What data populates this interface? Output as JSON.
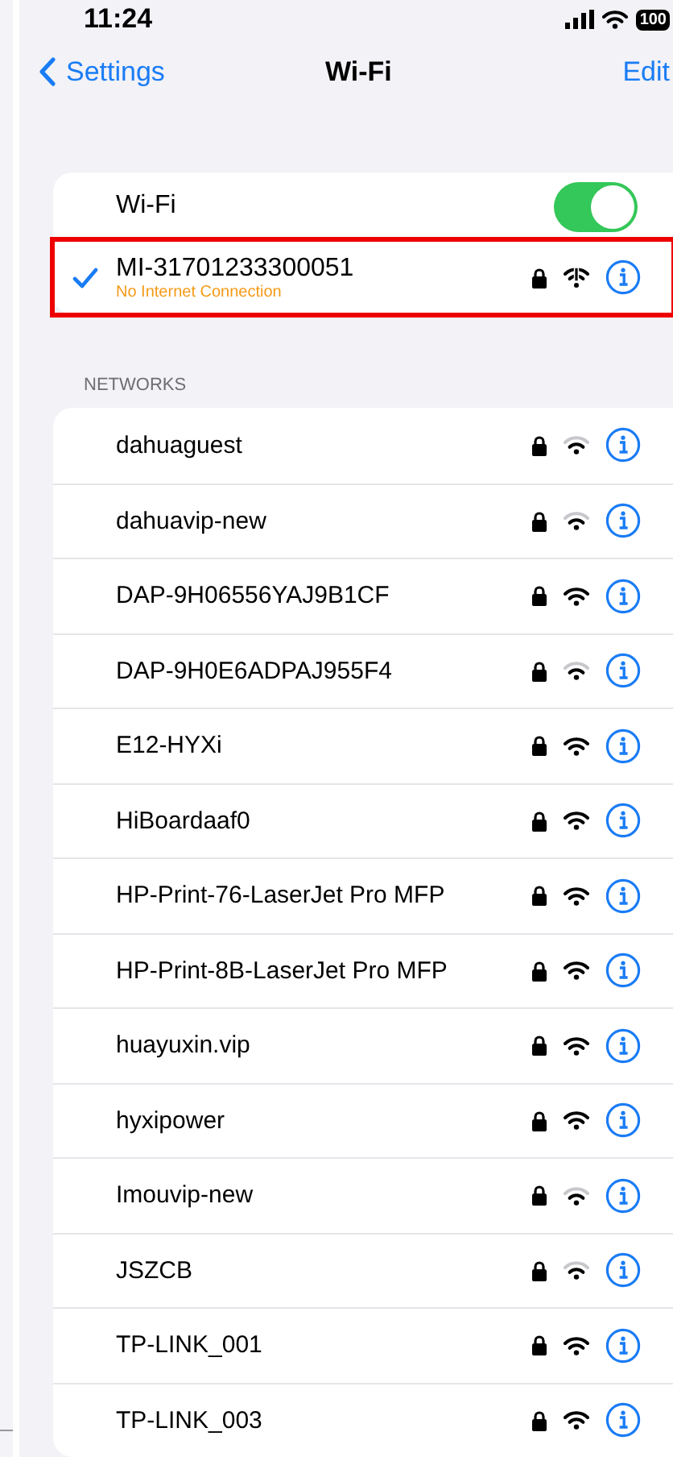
{
  "status_bar": {
    "time": "11:24",
    "battery": "100"
  },
  "nav": {
    "back": "Settings",
    "title": "Wi-Fi",
    "action": "Edit"
  },
  "wifi_toggle": {
    "label": "Wi-Fi",
    "on": true
  },
  "connected": {
    "name": "MI-31701233300051",
    "status": "No Internet Connection",
    "selected": true,
    "secured": true,
    "highlighted": true
  },
  "networks_header": "NETWORKS",
  "networks": [
    {
      "name": "dahuaguest",
      "secured": true,
      "strong": false
    },
    {
      "name": "dahuavip-new",
      "secured": true,
      "strong": false
    },
    {
      "name": "DAP-9H06556YAJ9B1CF",
      "secured": true,
      "strong": true
    },
    {
      "name": "DAP-9H0E6ADPAJ955F4",
      "secured": true,
      "strong": false
    },
    {
      "name": "E12-HYXi",
      "secured": true,
      "strong": true
    },
    {
      "name": "HiBoardaaf0",
      "secured": true,
      "strong": true
    },
    {
      "name": "HP-Print-76-LaserJet Pro MFP",
      "secured": true,
      "strong": true
    },
    {
      "name": "HP-Print-8B-LaserJet Pro MFP",
      "secured": true,
      "strong": true
    },
    {
      "name": "huayuxin.vip",
      "secured": true,
      "strong": true
    },
    {
      "name": "hyxipower",
      "secured": true,
      "strong": true
    },
    {
      "name": "Imouvip-new",
      "secured": true,
      "strong": false
    },
    {
      "name": "JSZCB",
      "secured": true,
      "strong": false
    },
    {
      "name": "TP-LINK_001",
      "secured": true,
      "strong": true
    },
    {
      "name": "TP-LINK_003",
      "secured": true,
      "strong": true
    }
  ]
}
